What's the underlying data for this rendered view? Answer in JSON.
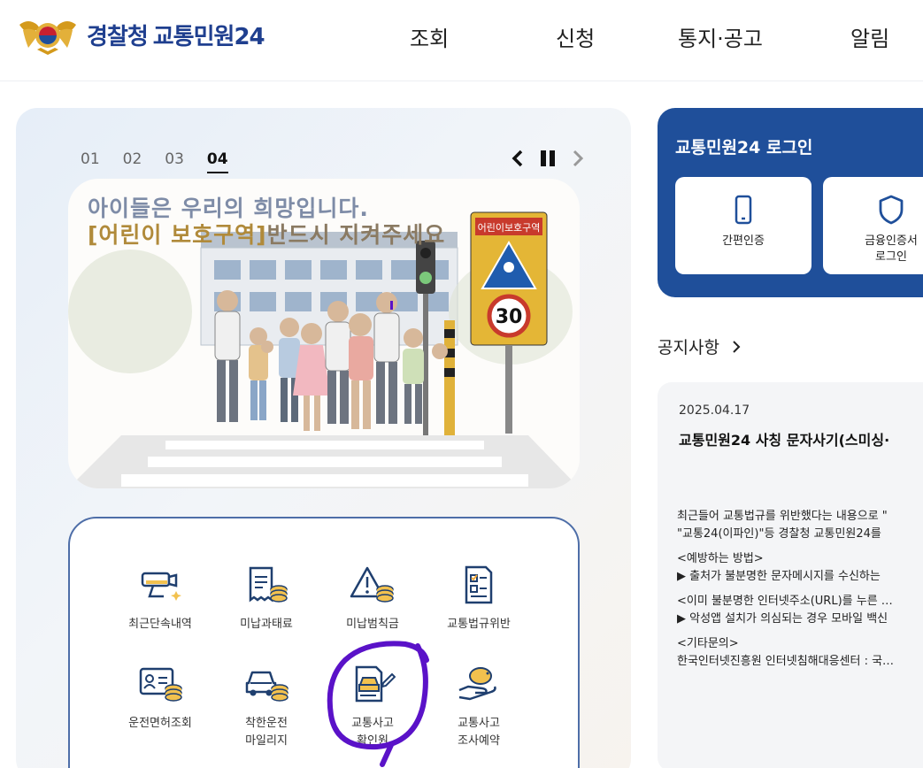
{
  "header": {
    "logo_primary": "경찰청",
    "logo_secondary": "교통민원24",
    "nav": [
      "조회",
      "신청",
      "통지·공고",
      "알림"
    ]
  },
  "carousel": {
    "pages": [
      "01",
      "02",
      "03",
      "04"
    ],
    "active_page": "04",
    "banner_line1": "아이들은 우리의 희망입니다.",
    "banner_line2_highlight": "[어린이 보호구역]",
    "banner_line2_rest": "반드시 지켜주세요",
    "sign_text": "어린이보호구역",
    "speed_limit": "30"
  },
  "services": [
    {
      "label": "최근단속내역",
      "icon": "cctv-camera-icon"
    },
    {
      "label": "미납과태료",
      "icon": "receipt-coins-icon"
    },
    {
      "label": "미납범칙금",
      "icon": "warning-coins-icon"
    },
    {
      "label": "교통법규위반",
      "icon": "checklist-document-icon"
    },
    {
      "label": "운전면허조회",
      "icon": "license-card-icon"
    },
    {
      "label": "착한운전\n마일리지",
      "icon": "car-coins-icon"
    },
    {
      "label": "교통사고\n확인원",
      "icon": "accident-document-icon"
    },
    {
      "label": "교통사고\n조사예약",
      "icon": "hand-piggybank-icon"
    }
  ],
  "login": {
    "title": "교통민원24 로그인",
    "simple_auth": "간편인증",
    "financial_cert": "금융인증서\n로그인"
  },
  "notice": {
    "heading": "공지사항",
    "date": "2025.04.17",
    "title": "교통민원24 사칭 문자사기(스미싱·",
    "lines": [
      "최근들어 교통법규를 위반했다는 내용으로 \"",
      "\"교통24(이파인)\"등 경찰청 교통민원24를",
      "",
      "<예방하는 방법>",
      "▶ 출처가 불분명한 문자메시지를 수신하는",
      "",
      "<이미 불분명한 인터넷주소(URL)를 누른 …",
      "▶ 악성앱 설치가 의심되는 경우 모바일 백신",
      "",
      "<기타문의>",
      "한국인터넷진흥원 인터넷침해대응센터 : 국…"
    ]
  },
  "colors": {
    "brand_blue": "#1f4f9a",
    "annotation_purple": "#5a12c8"
  }
}
